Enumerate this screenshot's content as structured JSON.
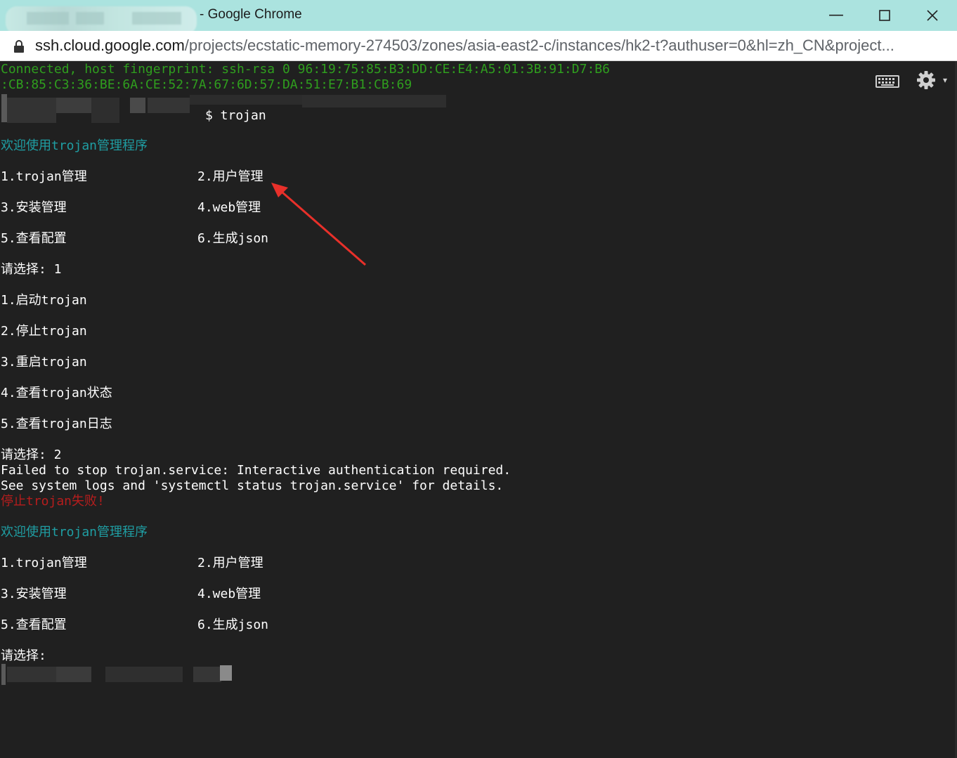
{
  "window": {
    "title": "- Google Chrome",
    "minimize_glyph": "—",
    "maximize_glyph": "☐",
    "close_glyph": "✕"
  },
  "address": {
    "host": "ssh.cloud.google.com",
    "path": "/projects/ecstatic-memory-274503/zones/asia-east2-c/instances/hk2-t?authuser=0&hl=zh_CN&project..."
  },
  "toolbar": {
    "keyboard_icon": "keyboard-icon",
    "settings_icon": "gear-icon",
    "dropdown_glyph": "▾"
  },
  "colors": {
    "terminal_bg": "#202020",
    "green": "#2f9e1e",
    "cyan": "#1f9ea3",
    "red": "#b61d1d",
    "annotation_arrow": "#e8302a"
  },
  "terminal": {
    "fingerprint_1": "Connected, host fingerprint: ssh-rsa 0 96:19:75:85:B3:DD:CE:E4:A5:01:3B:91:D7:B6",
    "fingerprint_2": ":CB:85:C3:36:BE:6A:CE:52:7A:67:6D:57:DA:51:E7:B1:CB:69",
    "prompt_cmd": "$ trojan",
    "welcome_1": "欢迎使用trojan管理程序",
    "menu_1": {
      "item1": "1.trojan管理",
      "item2": "2.用户管理",
      "item3": "3.安装管理",
      "item4": "4.web管理",
      "item5": "5.查看配置",
      "item6": "6.生成json"
    },
    "choice_1": "请选择: 1",
    "submenu": {
      "item1": "1.启动trojan",
      "item2": "2.停止trojan",
      "item3": "3.重启trojan",
      "item4": "4.查看trojan状态",
      "item5": "5.查看trojan日志"
    },
    "choice_2": "请选择: 2",
    "error_1": "Failed to stop trojan.service: Interactive authentication required.",
    "error_2": "See system logs and 'systemctl status trojan.service' for details.",
    "error_cn": "停止trojan失败!",
    "welcome_2": "欢迎使用trojan管理程序",
    "menu_2": {
      "item1": "1.trojan管理",
      "item2": "2.用户管理",
      "item3": "3.安装管理",
      "item4": "4.web管理",
      "item5": "5.查看配置",
      "item6": "6.生成json"
    },
    "choice_3": "请选择:"
  }
}
